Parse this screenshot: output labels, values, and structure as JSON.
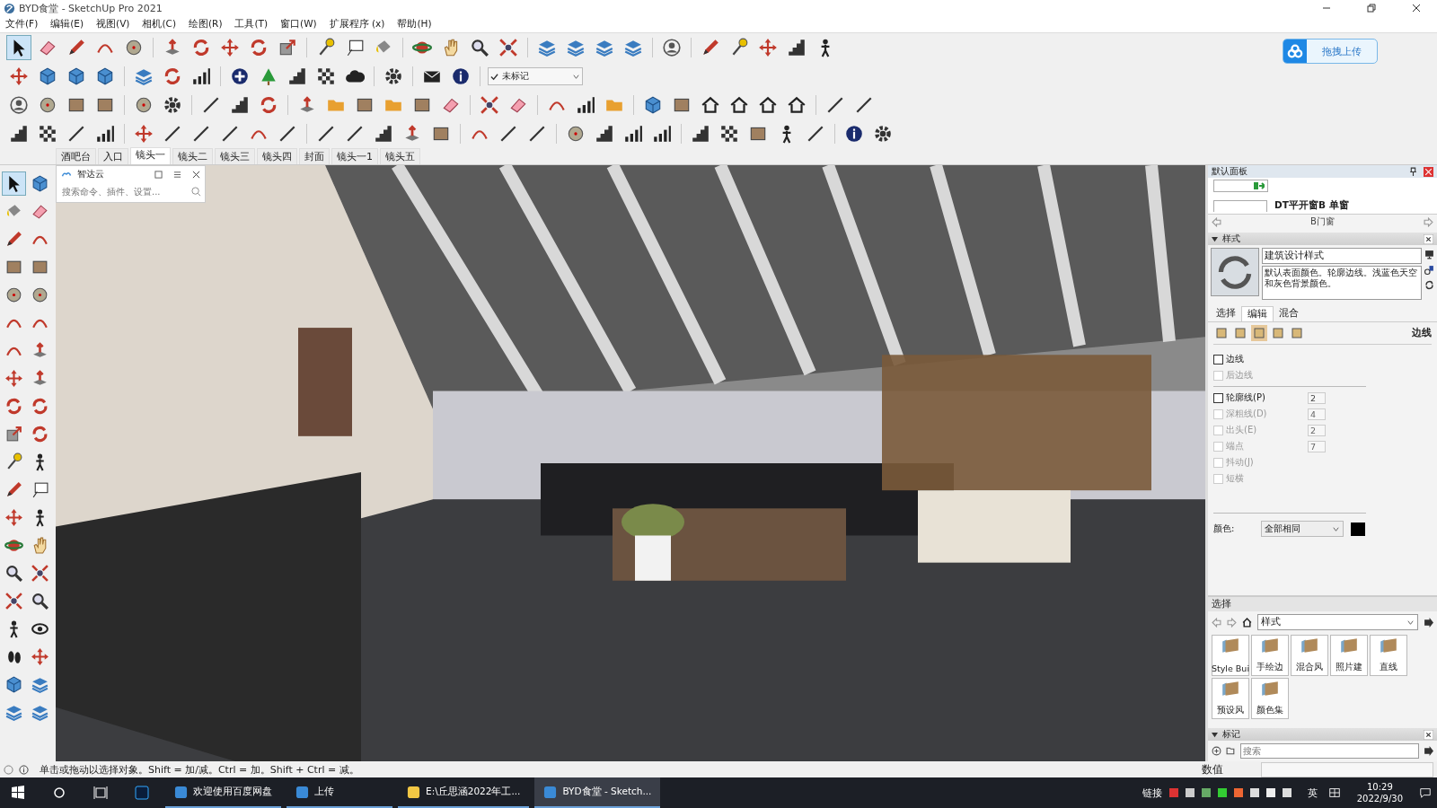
{
  "window": {
    "title": "BYD食堂 - SketchUp Pro 2021"
  },
  "menu": [
    "文件(F)",
    "编辑(E)",
    "视图(V)",
    "相机(C)",
    "绘图(R)",
    "工具(T)",
    "窗口(W)",
    "扩展程序 (x)",
    "帮助(H)"
  ],
  "upload_widget": {
    "label": "拖拽上传"
  },
  "tools": {
    "select_active": true
  },
  "tag_dropdown": {
    "value": "未标记"
  },
  "scenes": [
    {
      "label": "酒吧台",
      "selected": false
    },
    {
      "label": "入口",
      "selected": false
    },
    {
      "label": "镜头一",
      "selected": true
    },
    {
      "label": "镜头二",
      "selected": false
    },
    {
      "label": "镜头三",
      "selected": false
    },
    {
      "label": "镜头四",
      "selected": false
    },
    {
      "label": "封面",
      "selected": false
    },
    {
      "label": "镜头一1",
      "selected": false
    },
    {
      "label": "镜头五",
      "selected": false
    }
  ],
  "search_panel": {
    "title": "智达云",
    "placeholder": "搜索命令、插件、设置..."
  },
  "tray": {
    "title": "默认面板",
    "component": {
      "name": "DT平开窗B 单窗",
      "category": "B门窗"
    },
    "styles": {
      "title": "样式",
      "name": "建筑设计样式",
      "description": "默认表面颜色。轮廓边线。浅蓝色天空和灰色背景颜色。",
      "tabs": [
        {
          "label": "选择",
          "selected": false
        },
        {
          "label": "编辑",
          "selected": true
        },
        {
          "label": "混合",
          "selected": false
        }
      ],
      "edit_modes": [
        {
          "selected": false
        },
        {
          "selected": false
        },
        {
          "selected": true
        },
        {
          "selected": false
        },
        {
          "selected": false
        }
      ],
      "section_title": "边线",
      "options": [
        {
          "label": "边线",
          "checked": false,
          "disabled": false
        },
        {
          "label": "后边线",
          "checked": false,
          "disabled": true
        },
        {
          "label": "轮廓线(P)",
          "checked": false,
          "disabled": false,
          "value": "2"
        },
        {
          "label": "深粗线(D)",
          "checked": false,
          "disabled": true,
          "value": "4"
        },
        {
          "label": "出头(E)",
          "checked": false,
          "disabled": true,
          "value": "2"
        },
        {
          "label": "端点",
          "checked": false,
          "disabled": true,
          "value": "7"
        },
        {
          "label": "抖动(J)",
          "checked": false,
          "disabled": true
        },
        {
          "label": "短横",
          "checked": false,
          "disabled": true
        }
      ],
      "color_label": "颜色:",
      "color_mode": "全部相同",
      "color": "#000000"
    },
    "browser": {
      "title": "选择",
      "collection": "样式",
      "folders": [
        "Style Bui",
        "手绘边",
        "混合风",
        "照片建",
        "直线",
        "预设风",
        "颜色集"
      ]
    },
    "tags": {
      "title": "标记",
      "placeholder": "搜索"
    }
  },
  "status_bar": {
    "message": "单击或拖动以选择对象。Shift = 加/减。Ctrl = 加。Shift + Ctrl = 减。",
    "measurements_label": "数值"
  },
  "taskbar": {
    "items": [
      {
        "label": "欢迎使用百度网盘",
        "selected": false
      },
      {
        "label": "上传",
        "selected": false
      },
      {
        "label": "E:\\丘思涵2022年工...",
        "selected": false
      },
      {
        "label": "BYD食堂 - Sketch...",
        "selected": true
      }
    ],
    "tray_link": "链接",
    "ime": "英",
    "time": "10:29",
    "date": "2022/9/30"
  }
}
